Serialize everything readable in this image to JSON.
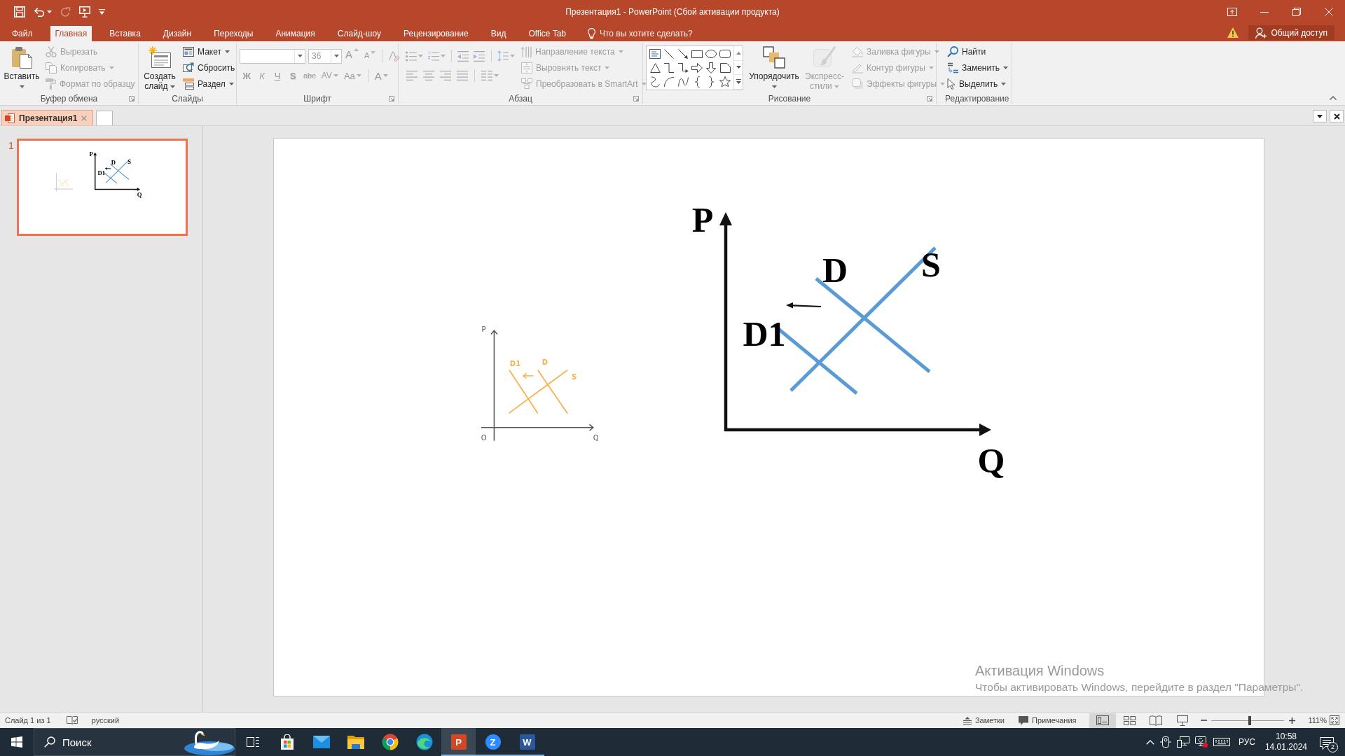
{
  "title_bar": {
    "quick_access": [
      {
        "kind": "save",
        "disabled": false,
        "dropdown": false
      },
      {
        "kind": "undo",
        "disabled": false,
        "dropdown": true
      },
      {
        "kind": "redo",
        "disabled": true,
        "dropdown": false
      },
      {
        "kind": "slideshow",
        "disabled": false,
        "dropdown": false
      },
      {
        "kind": "customize",
        "disabled": false,
        "dropdown": false
      }
    ],
    "title": "Презентация1 - PowerPoint (Сбой активации продукта)"
  },
  "ribbon_tabs": [
    {
      "label": "Файл",
      "selected": false
    },
    {
      "label": "Главная",
      "selected": true
    },
    {
      "label": "Вставка",
      "selected": false
    },
    {
      "label": "Дизайн",
      "selected": false
    },
    {
      "label": "Переходы",
      "selected": false
    },
    {
      "label": "Анимация",
      "selected": false
    },
    {
      "label": "Слайд-шоу",
      "selected": false
    },
    {
      "label": "Рецензирование",
      "selected": false
    },
    {
      "label": "Вид",
      "selected": false
    },
    {
      "label": "Office Tab",
      "selected": false
    }
  ],
  "tell_me": {
    "placeholder": "Что вы хотите сделать?"
  },
  "share_button": {
    "label": "Общий доступ"
  },
  "ribbon": {
    "groups": [
      {
        "kind": "clipboard",
        "label": "Буфер обмена",
        "launcher": true,
        "columns": [
          {
            "kind": "large",
            "buttons": [
              {
                "kind": "paste",
                "label": "Вставить",
                "disabled": false,
                "dropdown": true
              }
            ]
          },
          {
            "kind": "stack",
            "buttons": [
              {
                "kind": "cut",
                "label": "Вырезать",
                "disabled": true,
                "dropdown": false
              },
              {
                "kind": "copy",
                "label": "Копировать",
                "disabled": true,
                "dropdown": true
              },
              {
                "kind": "painter",
                "label": "Формат по образцу",
                "disabled": true,
                "dropdown": false
              }
            ]
          }
        ]
      },
      {
        "kind": "slides",
        "label": "Слайды",
        "launcher": false,
        "columns": [
          {
            "kind": "large",
            "buttons": [
              {
                "kind": "newslide",
                "label": "Создать слайд",
                "disabled": false,
                "dropdown": true
              }
            ]
          },
          {
            "kind": "stack",
            "buttons": [
              {
                "kind": "layout",
                "label": "Макет",
                "disabled": false,
                "dropdown": true
              },
              {
                "kind": "reset",
                "label": "Сбросить",
                "disabled": false,
                "dropdown": false
              },
              {
                "kind": "section",
                "label": "Раздел",
                "disabled": false,
                "dropdown": true
              }
            ]
          }
        ]
      },
      {
        "kind": "font",
        "label": "Шрифт",
        "launcher": true,
        "columns": [
          {
            "kind": "lines",
            "lines": [
              {
                "buttons": [
                  {
                    "kind": "fontname",
                    "disabled": true,
                    "dropdown": true
                  },
                  {
                    "kind": "fontsize",
                    "value": "36",
                    "disabled": true,
                    "dropdown": true
                  },
                  {
                    "kind": "grow",
                    "label": "A",
                    "disabled": true,
                    "dropdown": false
                  },
                  {
                    "kind": "shrink",
                    "label": "A",
                    "disabled": true,
                    "dropdown": false
                  },
                  {
                    "kind": "clear",
                    "disabled": true,
                    "dropdown": false
                  }
                ]
              },
              {
                "buttons": [
                  {
                    "kind": "bold",
                    "label": "Ж",
                    "disabled": true,
                    "dropdown": false
                  },
                  {
                    "kind": "italic",
                    "label": "К",
                    "disabled": true,
                    "dropdown": false
                  },
                  {
                    "kind": "underline",
                    "label": "Ч",
                    "disabled": true,
                    "dropdown": false
                  },
                  {
                    "kind": "shadow",
                    "label": "S",
                    "disabled": true,
                    "dropdown": false
                  },
                  {
                    "kind": "strike",
                    "label": "abc",
                    "disabled": true,
                    "dropdown": false
                  },
                  {
                    "kind": "spacing",
                    "label": "AV",
                    "disabled": true,
                    "dropdown": true
                  },
                  {
                    "kind": "case",
                    "label": "Aa",
                    "disabled": true,
                    "dropdown": true
                  },
                  {
                    "kind": "color",
                    "label": "A",
                    "disabled": true,
                    "dropdown": true
                  }
                ]
              }
            ]
          }
        ]
      },
      {
        "kind": "paragraph",
        "label": "Абзац",
        "launcher": true,
        "columns": [
          {
            "kind": "lines",
            "lines": [
              {
                "buttons": [
                  {
                    "kind": "bullets",
                    "disabled": true,
                    "dropdown": true
                  },
                  {
                    "kind": "numbering",
                    "disabled": true,
                    "dropdown": true
                  },
                  {
                    "kind": "outdent",
                    "disabled": true,
                    "dropdown": false
                  },
                  {
                    "kind": "indent",
                    "disabled": true,
                    "dropdown": false
                  },
                  {
                    "kind": "linespacing",
                    "disabled": true,
                    "dropdown": true
                  }
                ]
              },
              {
                "buttons": [
                  {
                    "kind": "left",
                    "disabled": true,
                    "dropdown": false
                  },
                  {
                    "kind": "center",
                    "disabled": true,
                    "dropdown": false
                  },
                  {
                    "kind": "right",
                    "disabled": true,
                    "dropdown": false
                  },
                  {
                    "kind": "justify",
                    "disabled": true,
                    "dropdown": false
                  },
                  {
                    "kind": "columns",
                    "disabled": true,
                    "dropdown": true
                  }
                ]
              }
            ]
          },
          {
            "kind": "stack",
            "buttons": [
              {
                "kind": "textdir",
                "label": "Направление текста",
                "disabled": true,
                "dropdown": true
              },
              {
                "kind": "aligntext",
                "label": "Выровнять текст",
                "disabled": true,
                "dropdown": true
              },
              {
                "kind": "smartart",
                "label": "Преобразовать в SmartArt",
                "disabled": true,
                "dropdown": true
              }
            ]
          }
        ]
      },
      {
        "kind": "drawing",
        "label": "Рисование",
        "launcher": true,
        "columns": [
          {
            "kind": "gallery"
          },
          {
            "kind": "large",
            "buttons": [
              {
                "kind": "arrange",
                "label": "Упорядочить",
                "disabled": false,
                "dropdown": true
              },
              {
                "kind": "quickstyles",
                "label": "Экспресс-стили",
                "disabled": true,
                "dropdown": true
              }
            ]
          },
          {
            "kind": "stack",
            "buttons": [
              {
                "kind": "fill",
                "label": "Заливка фигуры",
                "disabled": true,
                "dropdown": true
              },
              {
                "kind": "outline",
                "label": "Контур фигуры",
                "disabled": true,
                "dropdown": true
              },
              {
                "kind": "effects",
                "label": "Эффекты фигуры",
                "disabled": true,
                "dropdown": true
              }
            ]
          }
        ]
      },
      {
        "kind": "editing",
        "label": "Редактирование",
        "launcher": false,
        "columns": [
          {
            "kind": "stack",
            "buttons": [
              {
                "kind": "find",
                "label": "Найти",
                "disabled": false,
                "dropdown": false
              },
              {
                "kind": "replace",
                "label": "Заменить",
                "disabled": false,
                "dropdown": true
              },
              {
                "kind": "select",
                "label": "Выделить",
                "disabled": false,
                "dropdown": true
              }
            ]
          }
        ]
      }
    ]
  },
  "document_tabs": [
    {
      "label": "Презентация1",
      "selected": true
    }
  ],
  "slides_pane": {
    "thumbnails": [
      {
        "number": "1",
        "selected": true,
        "labels": {
          "price": "P",
          "demand": "D",
          "supply": "S",
          "new_demand": "D1",
          "quantity": "Q"
        }
      }
    ]
  },
  "slide": {
    "small_chart": {
      "labels": {
        "price": "P",
        "origin": "O",
        "quantity": "Q",
        "new_demand": "D1",
        "demand": "D",
        "supply": "S"
      }
    },
    "main_chart": {
      "labels": {
        "price": "P",
        "demand": "D",
        "supply": "S",
        "new_demand": "D1",
        "quantity": "Q"
      }
    }
  },
  "activation_notice": {
    "title": "Активация Windows",
    "message": "Чтобы активировать Windows, перейдите в раздел \"Параметры\"."
  },
  "status_bar": {
    "slide_counter": "Слайд 1 из 1",
    "language": "русский",
    "notes": "Заметки",
    "comments": "Примечания",
    "views": [
      {
        "kind": "normal",
        "selected": true
      },
      {
        "kind": "sorter",
        "selected": false
      },
      {
        "kind": "reading",
        "selected": false
      },
      {
        "kind": "slideshow",
        "selected": false
      }
    ],
    "zoom": {
      "level": 0.52,
      "value": "111%"
    }
  },
  "taskbar": {
    "search": {
      "placeholder": "Поиск"
    },
    "apps": [
      {
        "kind": "taskview",
        "open": false,
        "selected": false
      },
      {
        "kind": "store",
        "open": false,
        "selected": false
      },
      {
        "kind": "mail",
        "open": false,
        "selected": false
      },
      {
        "kind": "files",
        "open": false,
        "selected": false
      },
      {
        "kind": "ring",
        "open": false,
        "selected": false
      },
      {
        "kind": "wave",
        "open": false,
        "selected": false
      },
      {
        "kind": "slides",
        "glyph": "P",
        "open": true,
        "selected": true
      },
      {
        "kind": "meeting",
        "glyph": "Z",
        "open": true,
        "selected": false
      },
      {
        "kind": "document",
        "glyph": "W",
        "open": true,
        "selected": false
      }
    ],
    "tray": {
      "language": "РУС",
      "time": "10:58",
      "date": "14.01.2024",
      "notification_count": "2"
    }
  }
}
